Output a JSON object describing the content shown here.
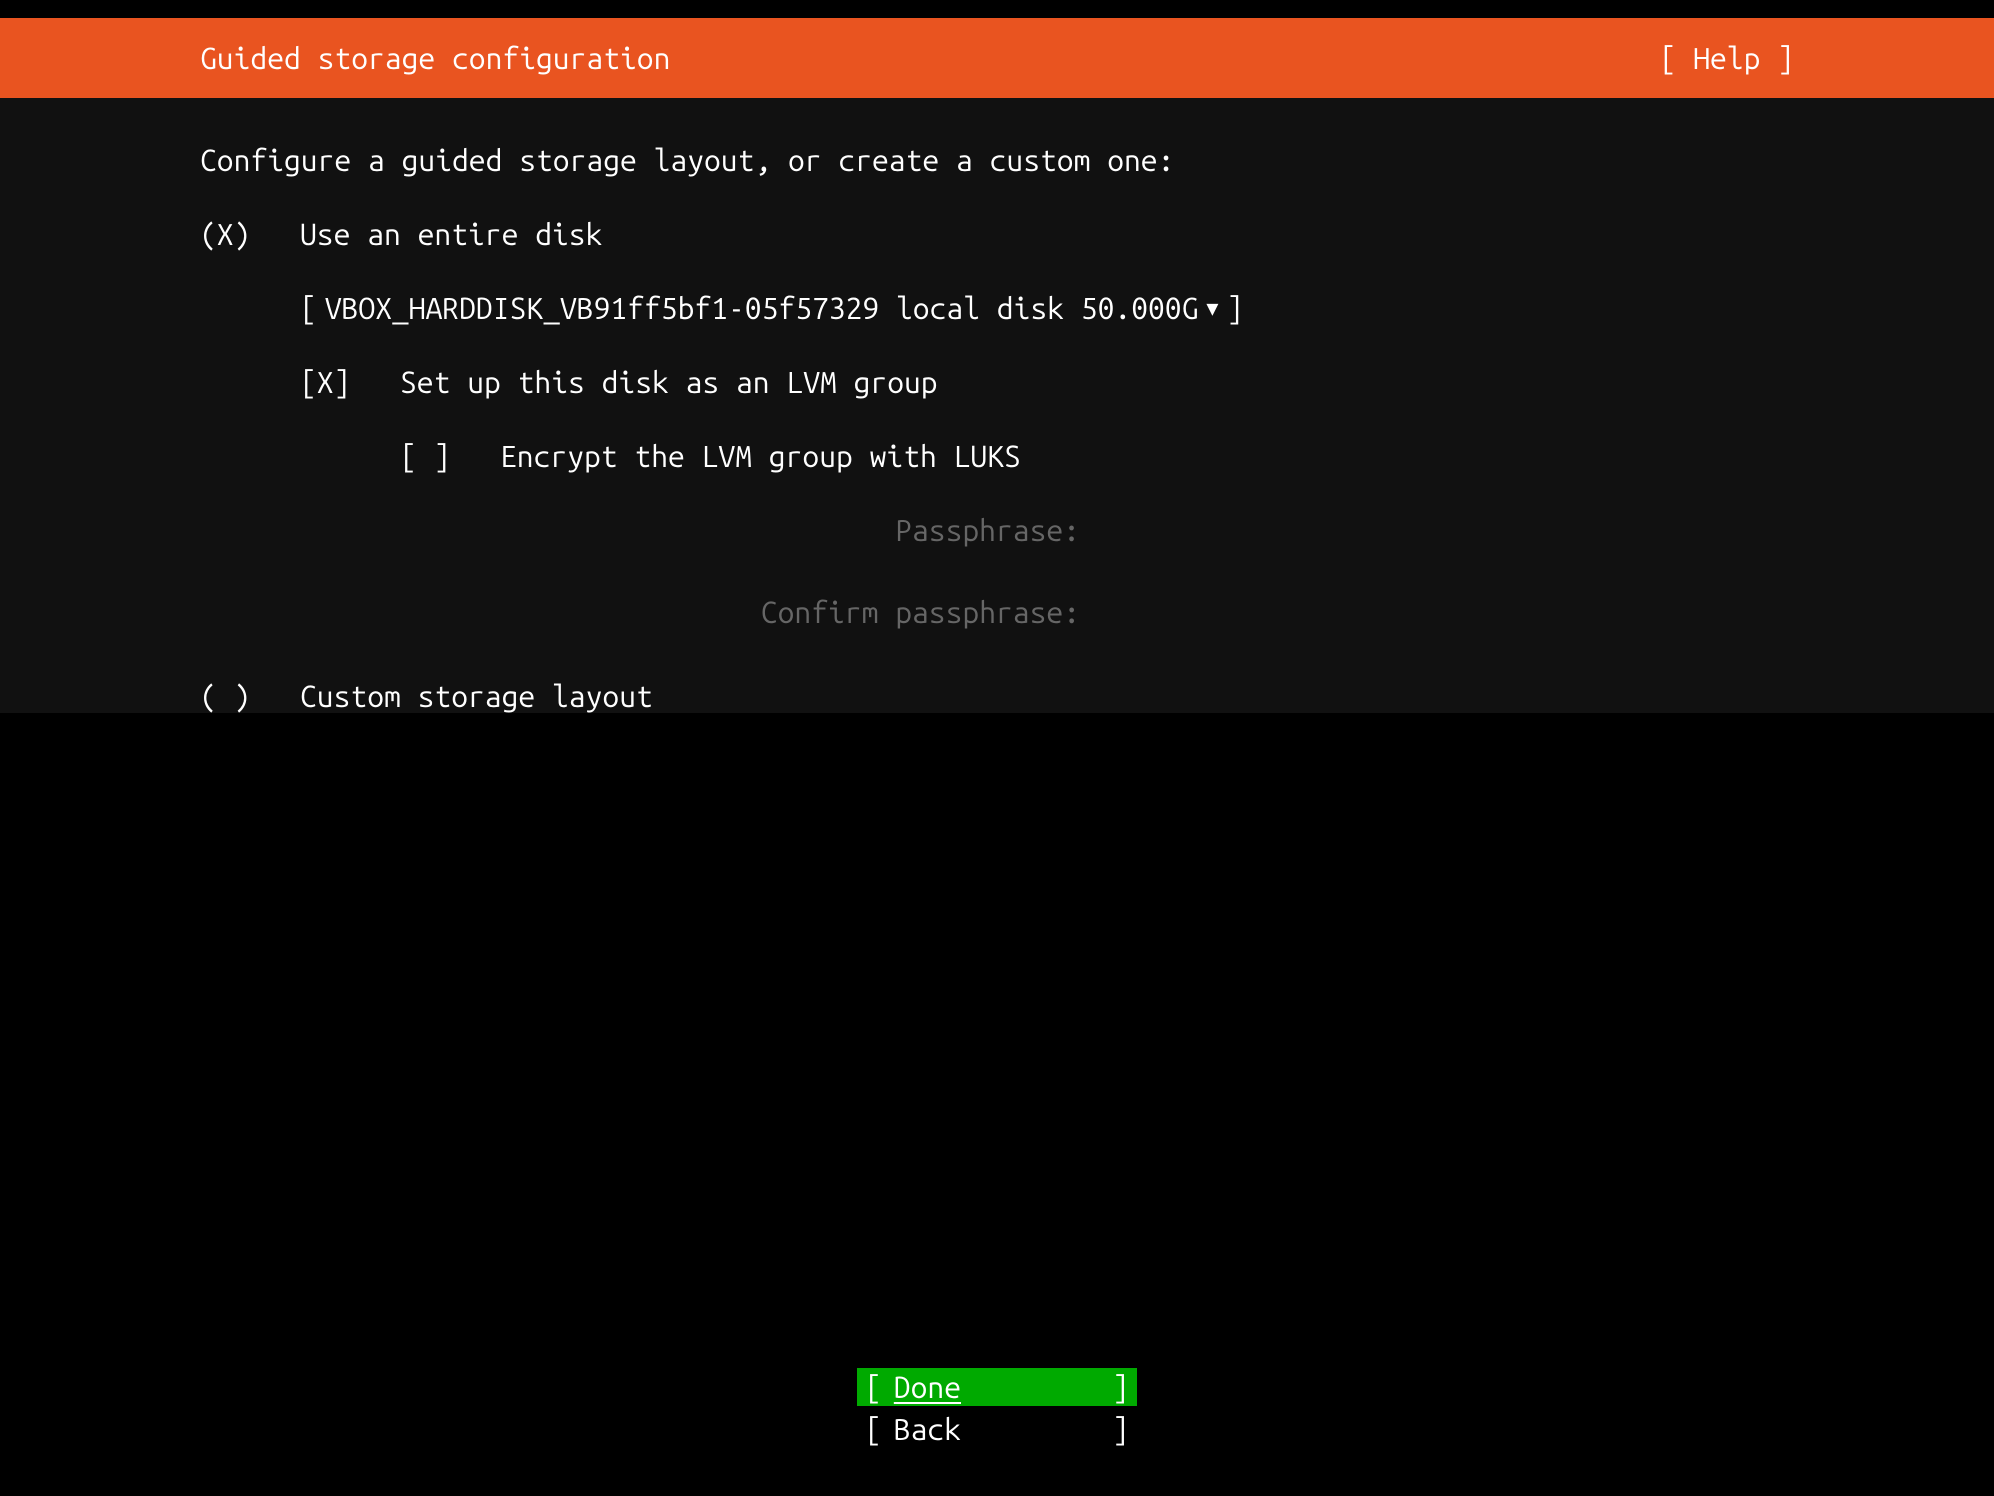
{
  "header": {
    "title": "Guided storage configuration",
    "help_label": "[ Help ]"
  },
  "instruction": "Configure a guided storage layout, or create a custom one:",
  "entire_disk": {
    "radio": "(X)",
    "label": "Use an entire disk"
  },
  "disk_select": {
    "open_bracket": "[",
    "value": "VBOX_HARDDISK_VB91ff5bf1-05f57329 local disk 50.000G",
    "close_bracket": "]"
  },
  "lvm": {
    "checkbox": "[X]",
    "label": "Set up this disk as an LVM group"
  },
  "luks": {
    "checkbox": "[ ]",
    "label": "Encrypt the LVM group with LUKS"
  },
  "passphrase": {
    "label": "Passphrase:",
    "confirm_label": "Confirm passphrase:"
  },
  "custom": {
    "radio": "( )",
    "label": "Custom storage layout"
  },
  "buttons": {
    "done": {
      "open": "[",
      "label": "Done",
      "close": "]"
    },
    "back": {
      "open": "[",
      "label": "Back",
      "close": "]"
    }
  }
}
